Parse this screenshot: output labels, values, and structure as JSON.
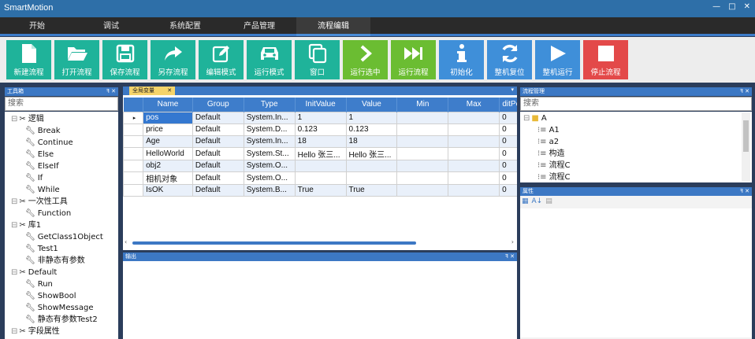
{
  "app": {
    "title": "SmartMotion",
    "win_min": "—",
    "win_max": "□",
    "win_close": "✕"
  },
  "menu": [
    "开始",
    "调试",
    "系统配置",
    "产品管理",
    "流程编辑"
  ],
  "toolbar": [
    {
      "label": "新建流程",
      "icon": "new-file-icon",
      "color": "#1fb39a"
    },
    {
      "label": "打开流程",
      "icon": "open-folder-icon",
      "color": "#1fb39a"
    },
    {
      "label": "保存流程",
      "icon": "save-icon",
      "color": "#1fb39a"
    },
    {
      "label": "另存流程",
      "icon": "share-arrow-icon",
      "color": "#1fb39a"
    },
    {
      "label": "编辑模式",
      "icon": "edit-icon",
      "color": "#1fb39a"
    },
    {
      "label": "运行模式",
      "icon": "car-icon",
      "color": "#1fb39a"
    },
    {
      "label": "窗口",
      "icon": "window-icon",
      "color": "#1fb39a"
    },
    {
      "label": "运行选中",
      "icon": "chevron-right-icon",
      "color": "#6bbd32"
    },
    {
      "label": "运行流程",
      "icon": "fast-forward-icon",
      "color": "#6bbd32"
    },
    {
      "label": "初始化",
      "icon": "info-icon",
      "color": "#3f8fd9"
    },
    {
      "label": "整机复位",
      "icon": "refresh-icon",
      "color": "#3f8fd9"
    },
    {
      "label": "整机运行",
      "icon": "play-icon",
      "color": "#3f8fd9"
    },
    {
      "label": "停止流程",
      "icon": "stop-icon",
      "color": "#e34949"
    }
  ],
  "toolbox": {
    "title": "工具箱",
    "pin": "ꟻ ✕",
    "search_placeholder": "搜索",
    "items": [
      {
        "label": "逻辑",
        "level": 0
      },
      {
        "label": "Break",
        "level": 1
      },
      {
        "label": "Continue",
        "level": 1
      },
      {
        "label": "Else",
        "level": 1
      },
      {
        "label": "ElseIf",
        "level": 1
      },
      {
        "label": "If",
        "level": 1
      },
      {
        "label": "While",
        "level": 1
      },
      {
        "label": "一次性工具",
        "level": 0
      },
      {
        "label": "Function",
        "level": 1
      },
      {
        "label": "库1",
        "level": 0
      },
      {
        "label": "GetClass1Object",
        "level": 1
      },
      {
        "label": "Test1",
        "level": 1
      },
      {
        "label": "非静态有参数",
        "level": 1
      },
      {
        "label": "Default",
        "level": 0
      },
      {
        "label": "Run",
        "level": 1
      },
      {
        "label": "ShowBool",
        "level": 1
      },
      {
        "label": "ShowMessage",
        "level": 1
      },
      {
        "label": "静态有参数Test2",
        "level": 1
      },
      {
        "label": "字段属性",
        "level": 0
      }
    ]
  },
  "vars": {
    "tab": "全局变量",
    "tab_close": "✕",
    "columns": [
      "Name",
      "Group",
      "Type",
      "InitValue",
      "Value",
      "Min",
      "Max",
      "ditPerm"
    ],
    "rows": [
      [
        "pos",
        "Default",
        "System.In...",
        "1",
        "1",
        "",
        "",
        "0"
      ],
      [
        "price",
        "Default",
        "System.D...",
        "0.123",
        "0.123",
        "",
        "",
        "0"
      ],
      [
        "Age",
        "Default",
        "System.In...",
        "18",
        "18",
        "",
        "",
        "0"
      ],
      [
        "HelloWorld",
        "Default",
        "System.St...",
        "Hello 张三...",
        "Hello 张三...",
        "",
        "",
        "0"
      ],
      [
        "obj2",
        "Default",
        "System.O...",
        "",
        "",
        "",
        "",
        "0"
      ],
      [
        "相机对象",
        "Default",
        "System.O...",
        "",
        "",
        "",
        "",
        "0"
      ],
      [
        "IsOK",
        "Default",
        "System.B...",
        "True",
        "True",
        "",
        "",
        "0"
      ]
    ]
  },
  "output": {
    "title": "输出"
  },
  "flow": {
    "title": "流程管理",
    "search_placeholder": "搜索",
    "items": [
      {
        "label": "A",
        "level": 0
      },
      {
        "label": "A1",
        "level": 1
      },
      {
        "label": "a2",
        "level": 1
      },
      {
        "label": "构造",
        "level": 1
      },
      {
        "label": "流程C",
        "level": 1
      },
      {
        "label": "流程C",
        "level": 1
      }
    ]
  },
  "props": {
    "title": "属性"
  }
}
